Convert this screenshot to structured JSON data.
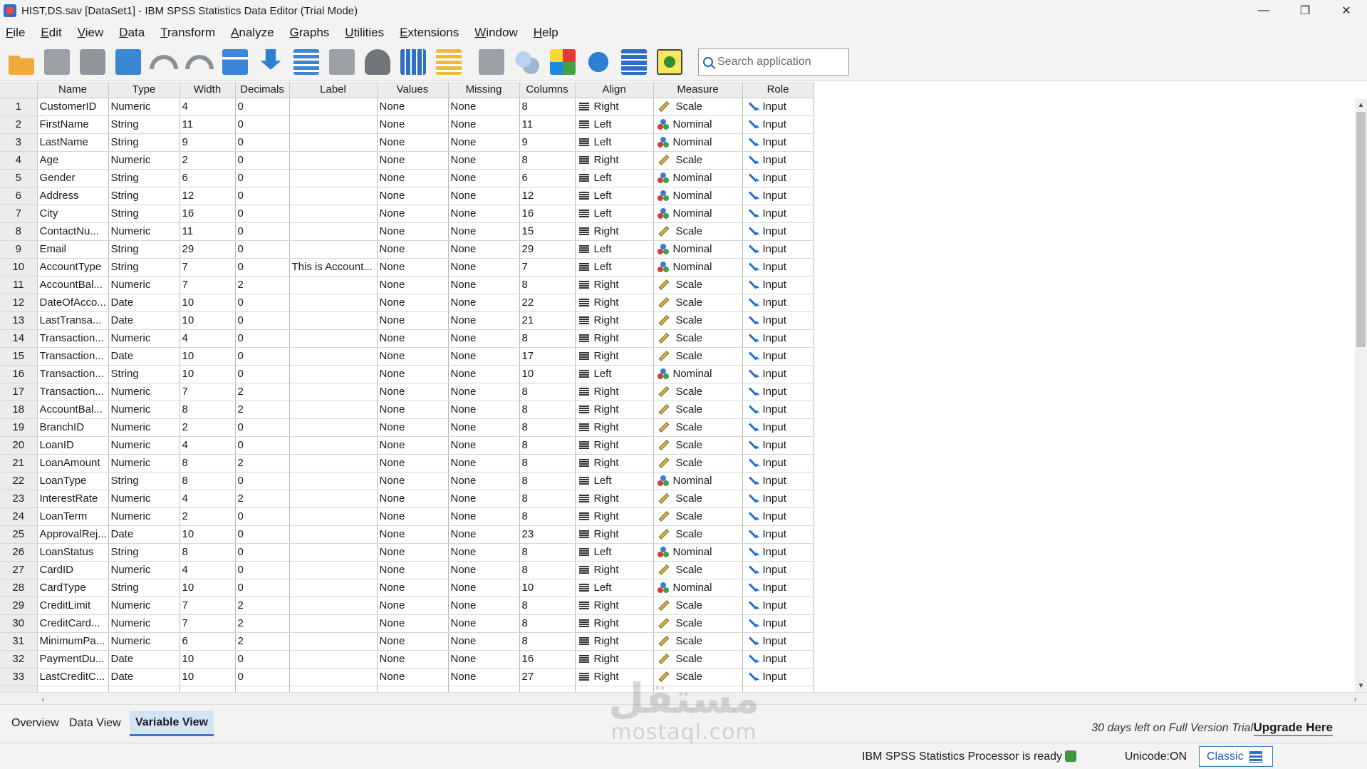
{
  "window": {
    "title": "HIST,DS.sav [DataSet1] - IBM SPSS Statistics Data Editor (Trial Mode)",
    "minimize": "—",
    "restore": "❐",
    "close": "✕"
  },
  "menu": [
    "File",
    "Edit",
    "View",
    "Data",
    "Transform",
    "Analyze",
    "Graphs",
    "Utilities",
    "Extensions",
    "Window",
    "Help"
  ],
  "toolbar": {
    "icons": [
      "open-icon",
      "save-icon",
      "print-icon",
      "dialog-recall-icon",
      "undo-icon",
      "redo-icon",
      "go-to-case-icon",
      "import-data-icon",
      "variables-icon",
      "chart-icon",
      "find-icon",
      "split-file-icon",
      "select-cases-icon",
      "value-labels-icon",
      "use-sets-icon",
      "colors-icon",
      "globe-icon",
      "table-icon",
      "add-on-icon"
    ],
    "search_placeholder": "Search application"
  },
  "grid": {
    "columns": [
      "Name",
      "Type",
      "Width",
      "Decimals",
      "Label",
      "Values",
      "Missing",
      "Columns",
      "Align",
      "Measure",
      "Role"
    ],
    "rows": [
      [
        "1",
        "CustomerID",
        "Numeric",
        "4",
        "0",
        "",
        "None",
        "None",
        "8",
        "Right",
        "Scale",
        "Input"
      ],
      [
        "2",
        "FirstName",
        "String",
        "11",
        "0",
        "",
        "None",
        "None",
        "11",
        "Left",
        "Nominal",
        "Input"
      ],
      [
        "3",
        "LastName",
        "String",
        "9",
        "0",
        "",
        "None",
        "None",
        "9",
        "Left",
        "Nominal",
        "Input"
      ],
      [
        "4",
        "Age",
        "Numeric",
        "2",
        "0",
        "",
        "None",
        "None",
        "8",
        "Right",
        "Scale",
        "Input"
      ],
      [
        "5",
        "Gender",
        "String",
        "6",
        "0",
        "",
        "None",
        "None",
        "6",
        "Left",
        "Nominal",
        "Input"
      ],
      [
        "6",
        "Address",
        "String",
        "12",
        "0",
        "",
        "None",
        "None",
        "12",
        "Left",
        "Nominal",
        "Input"
      ],
      [
        "7",
        "City",
        "String",
        "16",
        "0",
        "",
        "None",
        "None",
        "16",
        "Left",
        "Nominal",
        "Input"
      ],
      [
        "8",
        "ContactNu...",
        "Numeric",
        "11",
        "0",
        "",
        "None",
        "None",
        "15",
        "Right",
        "Scale",
        "Input"
      ],
      [
        "9",
        "Email",
        "String",
        "29",
        "0",
        "",
        "None",
        "None",
        "29",
        "Left",
        "Nominal",
        "Input"
      ],
      [
        "10",
        "AccountType",
        "String",
        "7",
        "0",
        "This is Account...",
        "None",
        "None",
        "7",
        "Left",
        "Nominal",
        "Input"
      ],
      [
        "11",
        "AccountBal...",
        "Numeric",
        "7",
        "2",
        "",
        "None",
        "None",
        "8",
        "Right",
        "Scale",
        "Input"
      ],
      [
        "12",
        "DateOfAcco...",
        "Date",
        "10",
        "0",
        "",
        "None",
        "None",
        "22",
        "Right",
        "Scale",
        "Input"
      ],
      [
        "13",
        "LastTransa...",
        "Date",
        "10",
        "0",
        "",
        "None",
        "None",
        "21",
        "Right",
        "Scale",
        "Input"
      ],
      [
        "14",
        "Transaction...",
        "Numeric",
        "4",
        "0",
        "",
        "None",
        "None",
        "8",
        "Right",
        "Scale",
        "Input"
      ],
      [
        "15",
        "Transaction...",
        "Date",
        "10",
        "0",
        "",
        "None",
        "None",
        "17",
        "Right",
        "Scale",
        "Input"
      ],
      [
        "16",
        "Transaction...",
        "String",
        "10",
        "0",
        "",
        "None",
        "None",
        "10",
        "Left",
        "Nominal",
        "Input"
      ],
      [
        "17",
        "Transaction...",
        "Numeric",
        "7",
        "2",
        "",
        "None",
        "None",
        "8",
        "Right",
        "Scale",
        "Input"
      ],
      [
        "18",
        "AccountBal...",
        "Numeric",
        "8",
        "2",
        "",
        "None",
        "None",
        "8",
        "Right",
        "Scale",
        "Input"
      ],
      [
        "19",
        "BranchID",
        "Numeric",
        "2",
        "0",
        "",
        "None",
        "None",
        "8",
        "Right",
        "Scale",
        "Input"
      ],
      [
        "20",
        "LoanID",
        "Numeric",
        "4",
        "0",
        "",
        "None",
        "None",
        "8",
        "Right",
        "Scale",
        "Input"
      ],
      [
        "21",
        "LoanAmount",
        "Numeric",
        "8",
        "2",
        "",
        "None",
        "None",
        "8",
        "Right",
        "Scale",
        "Input"
      ],
      [
        "22",
        "LoanType",
        "String",
        "8",
        "0",
        "",
        "None",
        "None",
        "8",
        "Left",
        "Nominal",
        "Input"
      ],
      [
        "23",
        "InterestRate",
        "Numeric",
        "4",
        "2",
        "",
        "None",
        "None",
        "8",
        "Right",
        "Scale",
        "Input"
      ],
      [
        "24",
        "LoanTerm",
        "Numeric",
        "2",
        "0",
        "",
        "None",
        "None",
        "8",
        "Right",
        "Scale",
        "Input"
      ],
      [
        "25",
        "ApprovalRej...",
        "Date",
        "10",
        "0",
        "",
        "None",
        "None",
        "23",
        "Right",
        "Scale",
        "Input"
      ],
      [
        "26",
        "LoanStatus",
        "String",
        "8",
        "0",
        "",
        "None",
        "None",
        "8",
        "Left",
        "Nominal",
        "Input"
      ],
      [
        "27",
        "CardID",
        "Numeric",
        "4",
        "0",
        "",
        "None",
        "None",
        "8",
        "Right",
        "Scale",
        "Input"
      ],
      [
        "28",
        "CardType",
        "String",
        "10",
        "0",
        "",
        "None",
        "None",
        "10",
        "Left",
        "Nominal",
        "Input"
      ],
      [
        "29",
        "CreditLimit",
        "Numeric",
        "7",
        "2",
        "",
        "None",
        "None",
        "8",
        "Right",
        "Scale",
        "Input"
      ],
      [
        "30",
        "CreditCard...",
        "Numeric",
        "7",
        "2",
        "",
        "None",
        "None",
        "8",
        "Right",
        "Scale",
        "Input"
      ],
      [
        "31",
        "MinimumPa...",
        "Numeric",
        "6",
        "2",
        "",
        "None",
        "None",
        "8",
        "Right",
        "Scale",
        "Input"
      ],
      [
        "32",
        "PaymentDu...",
        "Date",
        "10",
        "0",
        "",
        "None",
        "None",
        "16",
        "Right",
        "Scale",
        "Input"
      ],
      [
        "33",
        "LastCreditC...",
        "Date",
        "10",
        "0",
        "",
        "None",
        "None",
        "27",
        "Right",
        "Scale",
        "Input"
      ]
    ]
  },
  "tabs": {
    "overview": "Overview",
    "data_view": "Data View",
    "variable_view": "Variable View",
    "active": "Variable View"
  },
  "trial": {
    "text": "30 days left on Full Version Trial",
    "upgrade": "Upgrade Here"
  },
  "status": {
    "processor": "IBM SPSS Statistics Processor is ready",
    "unicode": "Unicode:ON",
    "mode": "Classic"
  },
  "watermark": {
    "arabic": "مستقل",
    "latin": "mostaql.com"
  }
}
